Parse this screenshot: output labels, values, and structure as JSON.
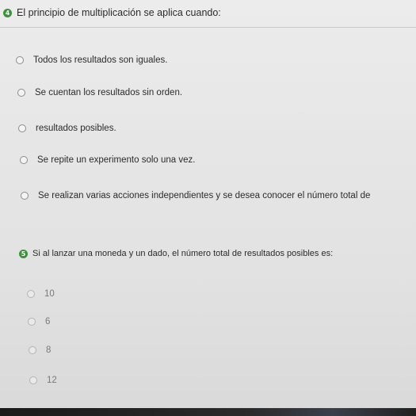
{
  "question1": {
    "number": "4",
    "text": "El principio de multiplicación se aplica cuando:",
    "options": [
      "Todos los resultados son iguales.",
      "Se cuentan los resultados sin orden.",
      "resultados posibles.",
      "Se repite un experimento solo una vez.",
      "Se realizan varias acciones independientes y se desea conocer el número total de"
    ]
  },
  "question2": {
    "number": "5",
    "text": "Si al lanzar una moneda y un dado, el número total de resultados posibles es:",
    "options": [
      "10",
      "6",
      "8",
      "12"
    ]
  }
}
